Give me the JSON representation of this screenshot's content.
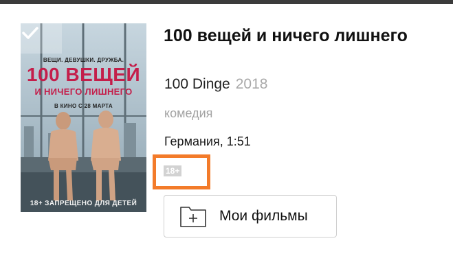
{
  "poster": {
    "tagline": "ВЕЩИ. ДЕВУШКИ. ДРУЖБА.",
    "title_big": "100 ВЕЩЕЙ",
    "title_sub": "И НИЧЕГО ЛИШНЕГО",
    "release": "В КИНО С 28 МАРТА",
    "bottom_text": "18+ ЗАПРЕЩЕНО ДЛЯ ДЕТЕЙ",
    "check_icon": "checkmark-icon"
  },
  "movie": {
    "title": "100 вещей и ничего лишнего",
    "original_title": "100 Dinge",
    "year": "2018",
    "genre": "комедия",
    "country_duration": "Германия, 1:51",
    "age_rating": "18+"
  },
  "actions": {
    "my_films_label": "Мои фильмы",
    "my_films_icon": "folder-plus-icon"
  },
  "colors": {
    "highlight": "#f37b2a",
    "poster_title": "#c41e4a",
    "secondary_text": "#a9a9a9"
  }
}
